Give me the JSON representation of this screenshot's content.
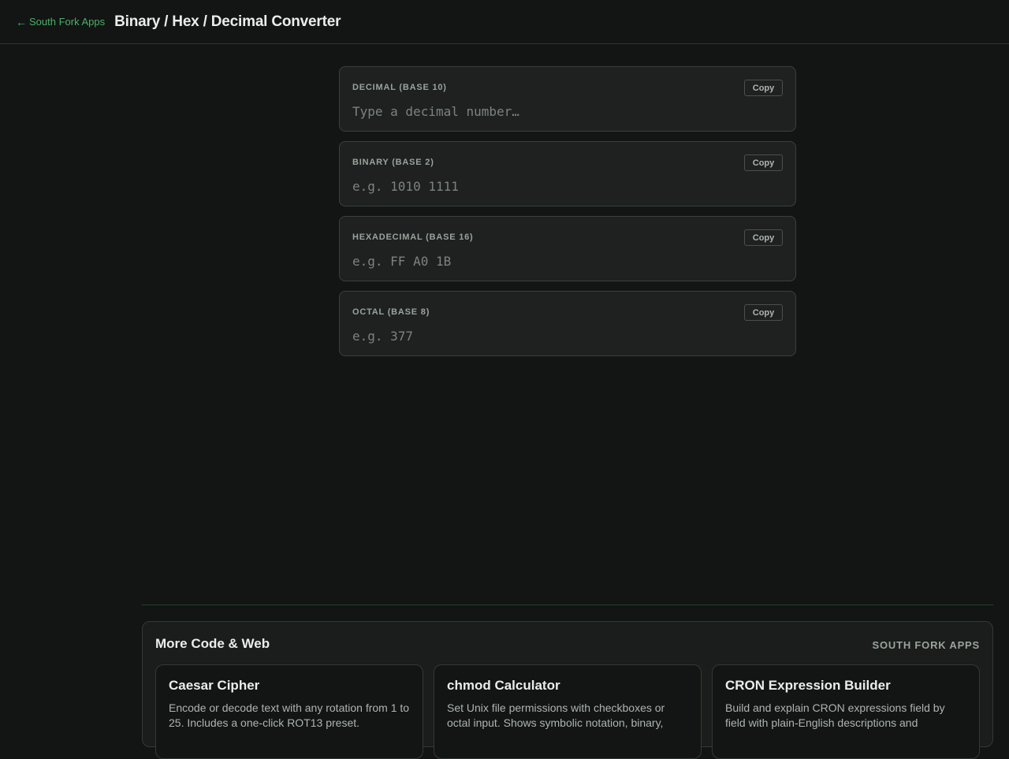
{
  "header": {
    "back_arrow": "←",
    "back_label": "South Fork Apps",
    "title": "Binary / Hex / Decimal Converter"
  },
  "fields": [
    {
      "label": "DECIMAL (BASE 10)",
      "placeholder": "Type a decimal number…",
      "value": "",
      "copy_label": "Copy"
    },
    {
      "label": "BINARY (BASE 2)",
      "placeholder": "e.g. 1010 1111",
      "value": "",
      "copy_label": "Copy"
    },
    {
      "label": "HEXADECIMAL (BASE 16)",
      "placeholder": "e.g. FF A0 1B",
      "value": "",
      "copy_label": "Copy"
    },
    {
      "label": "OCTAL (BASE 8)",
      "placeholder": "e.g. 377",
      "value": "",
      "copy_label": "Copy"
    }
  ],
  "more": {
    "title": "More Code & Web",
    "brand": "SOUTH FORK APPS",
    "cards": [
      {
        "title": "Caesar Cipher",
        "desc": "Encode or decode text with any rotation from 1 to 25. Includes a one-click ROT13 preset."
      },
      {
        "title": "chmod Calculator",
        "desc": "Set Unix file permissions with checkboxes or octal input. Shows symbolic notation, binary,"
      },
      {
        "title": "CRON Expression Builder",
        "desc": "Build and explain CRON expressions field by field with plain-English descriptions and"
      }
    ]
  },
  "colors": {
    "background": "#121514",
    "accent": "#4caf68",
    "panel": "#1e2120"
  }
}
